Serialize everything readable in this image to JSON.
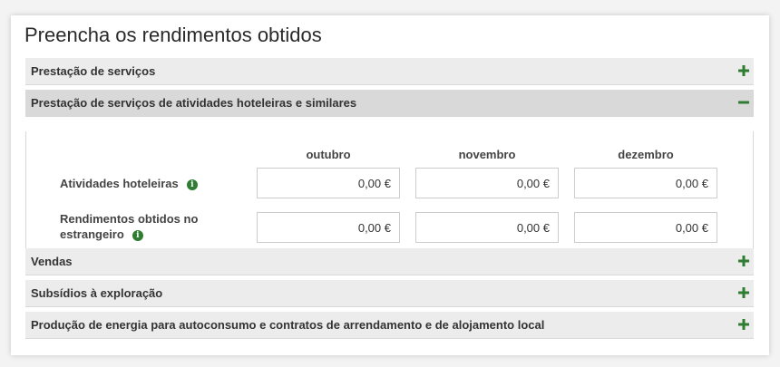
{
  "page": {
    "title": "Preencha os rendimentos obtidos"
  },
  "sections": [
    {
      "label": "Prestação de serviços",
      "state": "collapsed",
      "icon": "plus-icon"
    },
    {
      "label": "Prestação de serviços de atividades hoteleiras e similares",
      "state": "expanded",
      "icon": "minus-icon"
    },
    {
      "label": "Vendas",
      "state": "collapsed",
      "icon": "plus-icon"
    },
    {
      "label": "Subsídios à exploração",
      "state": "collapsed",
      "icon": "plus-icon"
    },
    {
      "label": "Produção de energia para autoconsumo e contratos de arrendamento e de alojamento local",
      "state": "collapsed",
      "icon": "plus-icon"
    }
  ],
  "months": [
    "outubro",
    "novembro",
    "dezembro"
  ],
  "rows": [
    {
      "label": "Atividades hoteleiras",
      "values": [
        "0,00 €",
        "0,00 €",
        "0,00 €"
      ]
    },
    {
      "label_line1": "Rendimentos obtidos no",
      "label_line2": "estrangeiro",
      "values": [
        "0,00 €",
        "0,00 €",
        "0,00 €"
      ]
    }
  ],
  "colors": {
    "accent": "#2e7d32",
    "section_bg": "#ececec",
    "section_open_bg": "#d9d9d9"
  }
}
